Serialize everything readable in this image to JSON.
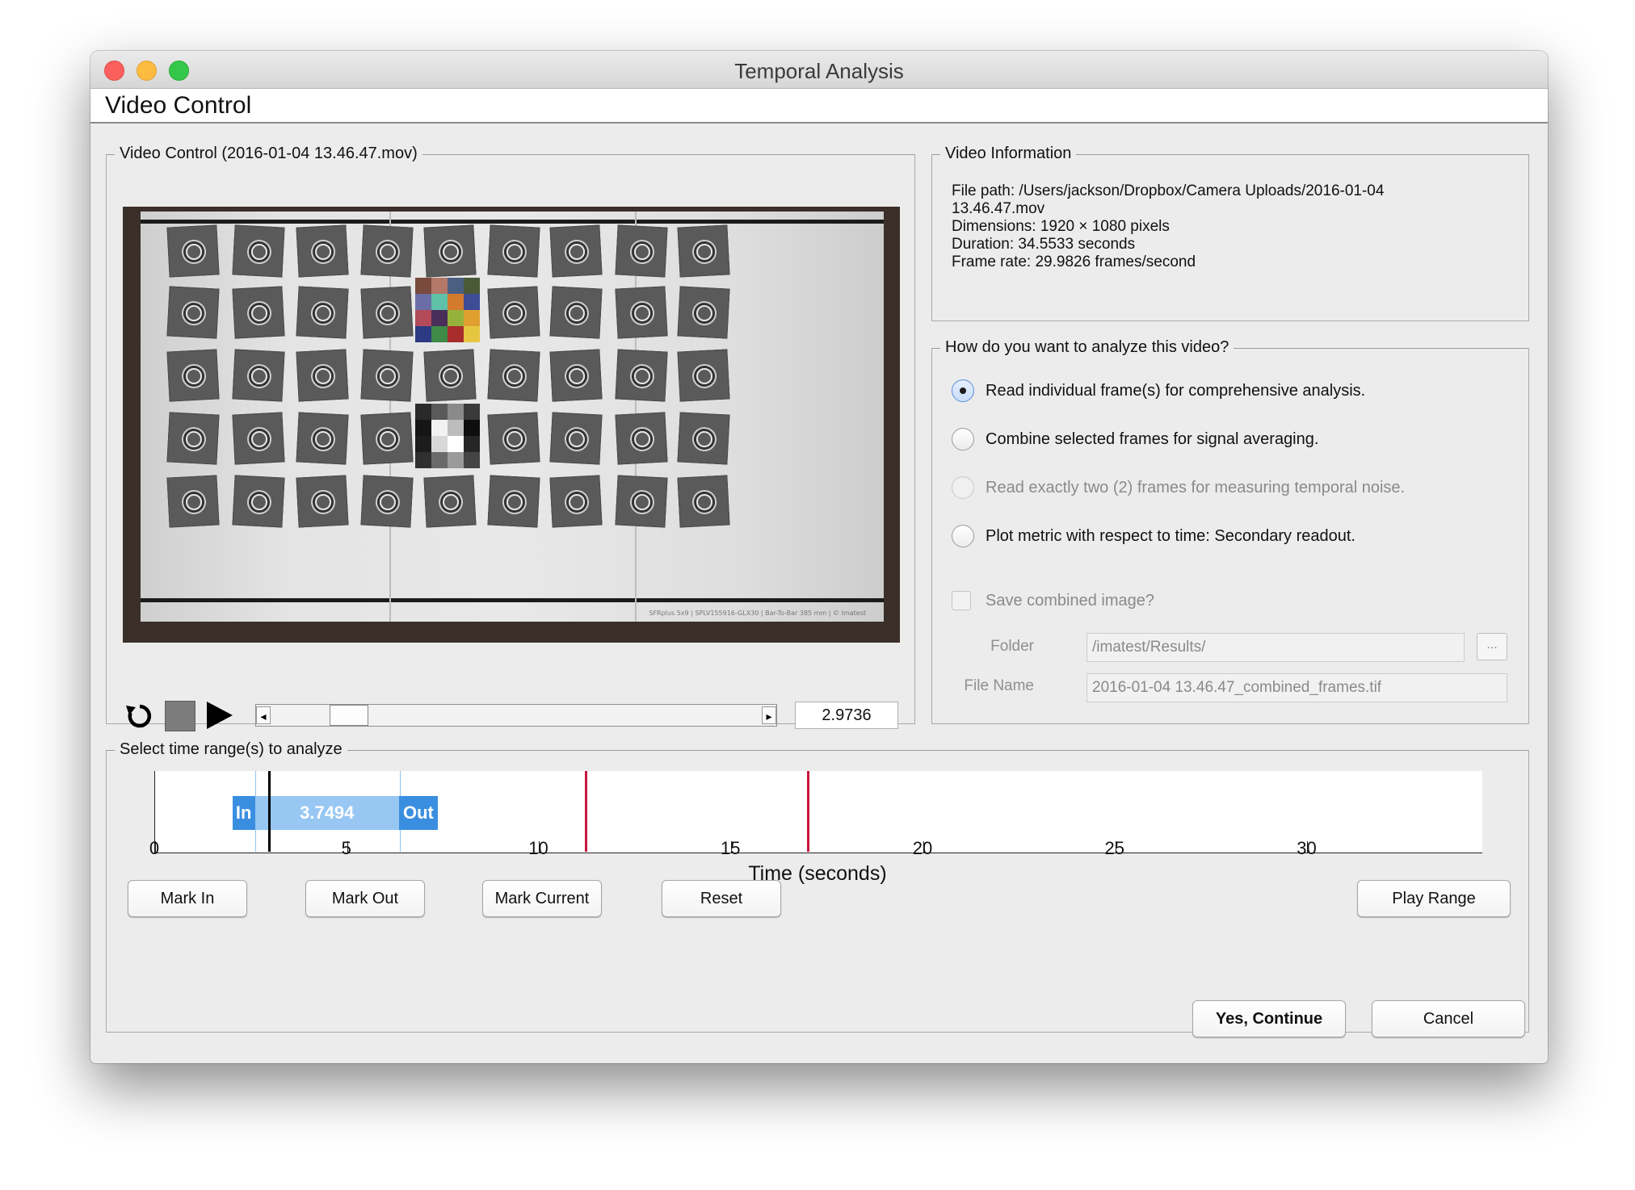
{
  "window": {
    "title": "Temporal Analysis"
  },
  "tab": {
    "label": "Video Control"
  },
  "video_control": {
    "group_title": "Video Control (2016-01-04 13.46.47.mov)",
    "frame_caption": "SFRplus 5x9 | SPLV155916-GLX30 | Bar-To-Bar 385 mm | © Imatest",
    "time_value": "2.9736",
    "slider_position": 0.13
  },
  "video_info": {
    "group_title": "Video Information",
    "lines": [
      "File path: /Users/jackson/Dropbox/Camera Uploads/2016-01-04",
      "13.46.47.mov",
      "Dimensions: 1920 × 1080 pixels",
      "Duration: 34.5533 seconds",
      "Frame rate: 29.9826 frames/second"
    ]
  },
  "analysis": {
    "group_title": "How do you want to analyze this video?",
    "options": [
      {
        "label": "Read individual frame(s) for comprehensive analysis.",
        "selected": true,
        "enabled": true
      },
      {
        "label": "Combine selected frames for signal averaging.",
        "selected": false,
        "enabled": true
      },
      {
        "label": "Read exactly two (2) frames for measuring temporal noise.",
        "selected": false,
        "enabled": false
      },
      {
        "label": "Plot metric with respect to time: Secondary readout.",
        "selected": false,
        "enabled": true
      }
    ],
    "save_combined_label": "Save combined image?",
    "folder_label": "Folder",
    "folder_value": "/imatest/Results/",
    "browse_label": "...",
    "filename_label": "File Name",
    "filename_value": "2016-01-04 13.46.47_combined_frames.tif"
  },
  "time_range": {
    "group_title": "Select time range(s) to analyze",
    "xlabel": "Time (seconds)",
    "ticks": [
      "0",
      "5",
      "10",
      "15",
      "20",
      "25",
      "30"
    ],
    "tick_values": [
      0,
      5,
      10,
      15,
      20,
      25,
      30
    ],
    "xlim": [
      0,
      34.5533
    ],
    "in_label": "In",
    "out_label": "Out",
    "range_label": "3.7494",
    "range_start": 2.6,
    "range_end": 6.3494,
    "current_time": 2.9736,
    "marks": [
      11.2,
      17.0
    ]
  },
  "buttons": {
    "mark_in": "Mark In",
    "mark_out": "Mark Out",
    "mark_current": "Mark Current",
    "reset": "Reset",
    "play_range": "Play Range",
    "continue": "Yes, Continue",
    "cancel": "Cancel"
  },
  "colors": {
    "range_in_out": "#3a8ee0",
    "range_fill": "#97c7f2",
    "mark_line": "#c8163e"
  }
}
